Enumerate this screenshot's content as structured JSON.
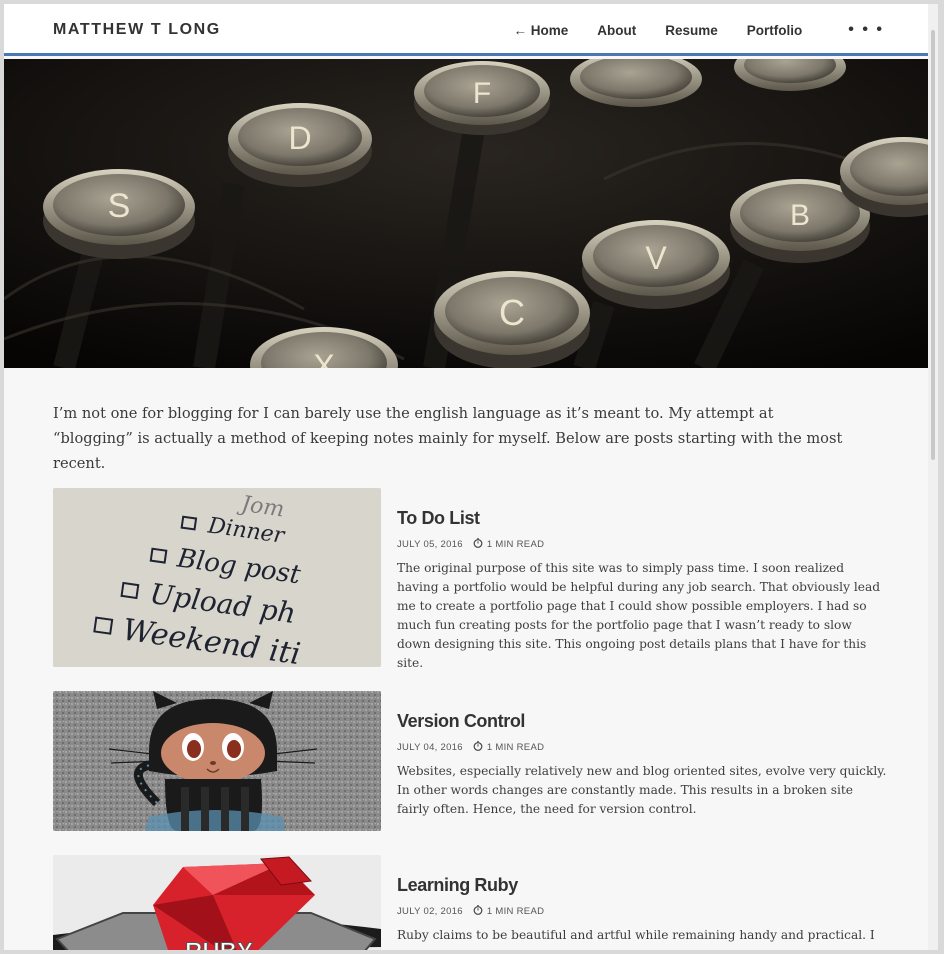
{
  "header": {
    "brand": "MATTHEW T LONG",
    "nav": [
      {
        "label": "← Home"
      },
      {
        "label": "About"
      },
      {
        "label": "Resume"
      },
      {
        "label": "Portfolio"
      }
    ],
    "more": "• • •"
  },
  "hero": {
    "keys": [
      "S",
      "D",
      "F",
      "C",
      "V",
      "B",
      "X"
    ]
  },
  "intro": "I’m not one for blogging for I can barely use the english language as it’s meant to. My attempt at “blogging” is actually a method of keeping notes mainly for myself. Below are posts starting with the most recent.",
  "posts": [
    {
      "title": "To Do List",
      "date": "JULY 05, 2016",
      "read": "1 MIN READ",
      "excerpt": "The original purpose of this site was to simply pass time. I soon realized having a portfolio would be helpful during any job search. That obviously lead me to create a portfolio page that I could show possible employers. I had so much fun creating posts for the portfolio page that I wasn’t ready to slow down designing this site. This ongoing post details plans that I have for this site.",
      "thumb_words": [
        "Dinner",
        "Blog post",
        "Upload ph",
        "Weekend iti"
      ]
    },
    {
      "title": "Version Control",
      "date": "JULY 04, 2016",
      "read": "1 MIN READ",
      "excerpt": "Websites, especially relatively new and blog oriented sites, evolve very quickly. In other words changes are constantly made. This results in a broken site fairly often. Hence, the need for version control."
    },
    {
      "title": "Learning Ruby",
      "date": "JULY 02, 2016",
      "read": "1 MIN READ",
      "excerpt": "Ruby claims to be beautiful and artful while remaining handy and practical. I am",
      "thumb_text": "RUBY"
    }
  ]
}
